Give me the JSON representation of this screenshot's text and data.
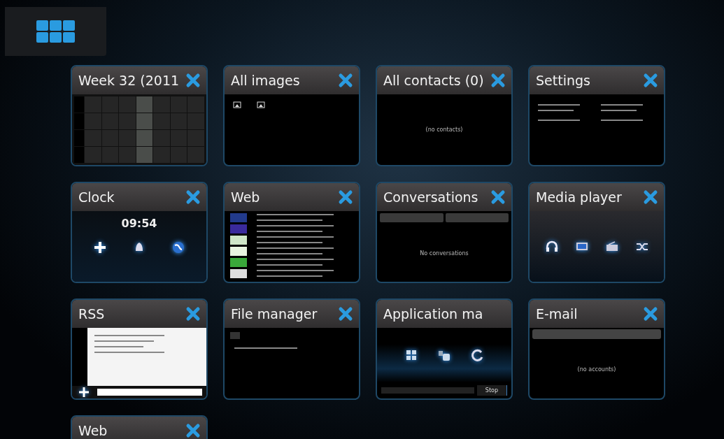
{
  "cards": [
    {
      "title": "Week 32 (2011",
      "closable": true,
      "kind": "calendar"
    },
    {
      "title": "All images",
      "closable": true,
      "kind": "images"
    },
    {
      "title": "All contacts (0)",
      "closable": true,
      "kind": "message",
      "message": "(no contacts)"
    },
    {
      "title": "Settings",
      "closable": true,
      "kind": "settings"
    },
    {
      "title": "Clock",
      "closable": true,
      "kind": "clock",
      "time": "09:54"
    },
    {
      "title": "Web",
      "closable": true,
      "kind": "web"
    },
    {
      "title": "Conversations",
      "closable": true,
      "kind": "conversations",
      "message": "No conversations"
    },
    {
      "title": "Media player",
      "closable": true,
      "kind": "media"
    },
    {
      "title": "RSS",
      "closable": true,
      "kind": "rss"
    },
    {
      "title": "File manager",
      "closable": true,
      "kind": "files"
    },
    {
      "title": "Application ma",
      "closable": false,
      "kind": "appmgr",
      "button": "Stop"
    },
    {
      "title": "E-mail",
      "closable": true,
      "kind": "email",
      "message": "(no accounts)"
    },
    {
      "title": "Web",
      "closable": true,
      "kind": "empty"
    }
  ]
}
